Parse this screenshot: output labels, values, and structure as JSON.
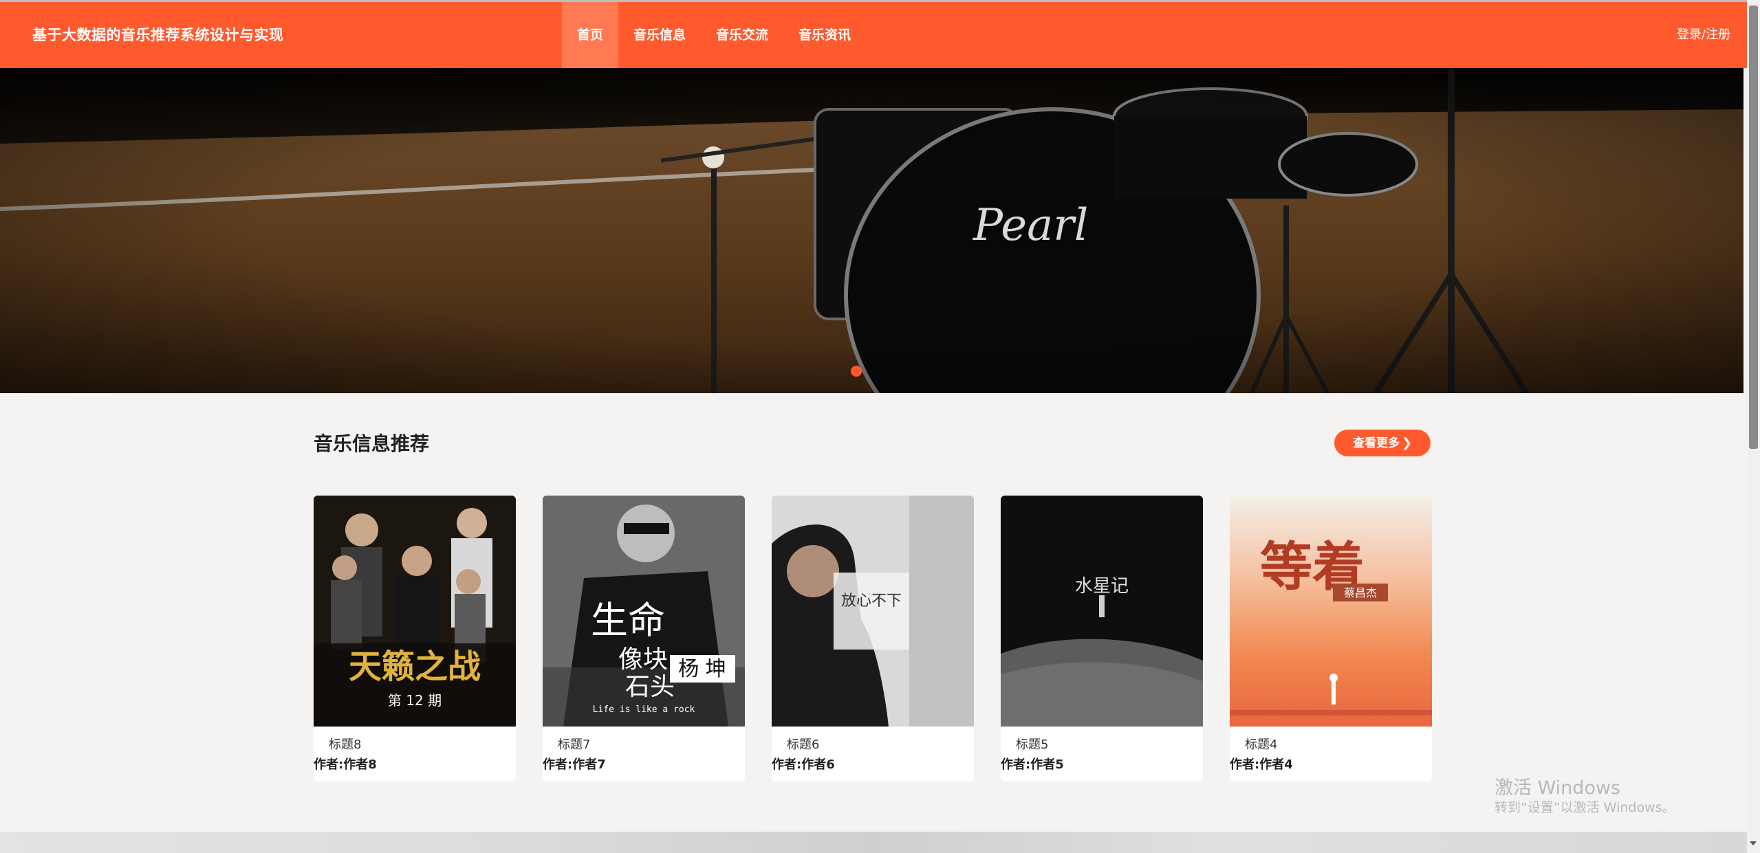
{
  "header": {
    "brand": "基于大数据的音乐推荐系统设计与实现",
    "nav": [
      {
        "label": "首页",
        "active": true
      },
      {
        "label": "音乐信息",
        "active": false
      },
      {
        "label": "音乐交流",
        "active": false
      },
      {
        "label": "音乐资讯",
        "active": false
      }
    ],
    "login": "登录/注册",
    "accent_color": "#ff5a2e"
  },
  "banner": {
    "brand_text": "Pearl",
    "slide_count": 1,
    "active_slide": 1
  },
  "section": {
    "title": "音乐信息推荐",
    "more_label": "查看更多",
    "more_icon": "chevron-right-icon"
  },
  "cards": [
    {
      "title": "标题8",
      "author": "作者:作者8",
      "cover_text": "天籁之战",
      "cover_sub": "第 12 期"
    },
    {
      "title": "标题7",
      "author": "作者:作者7",
      "cover_text": "生命像块石头",
      "cover_sub": "杨 坤",
      "cover_caption": "Life is like a rock"
    },
    {
      "title": "标题6",
      "author": "作者:作者6",
      "cover_text": "放心不下"
    },
    {
      "title": "标题5",
      "author": "作者:作者5",
      "cover_text": "水星记"
    },
    {
      "title": "标题4",
      "author": "作者:作者4",
      "cover_text": "等着",
      "cover_sub": "蔡昌杰"
    }
  ],
  "watermark": {
    "title": "激活 Windows",
    "subtitle": "转到“设置”以激活 Windows。"
  }
}
